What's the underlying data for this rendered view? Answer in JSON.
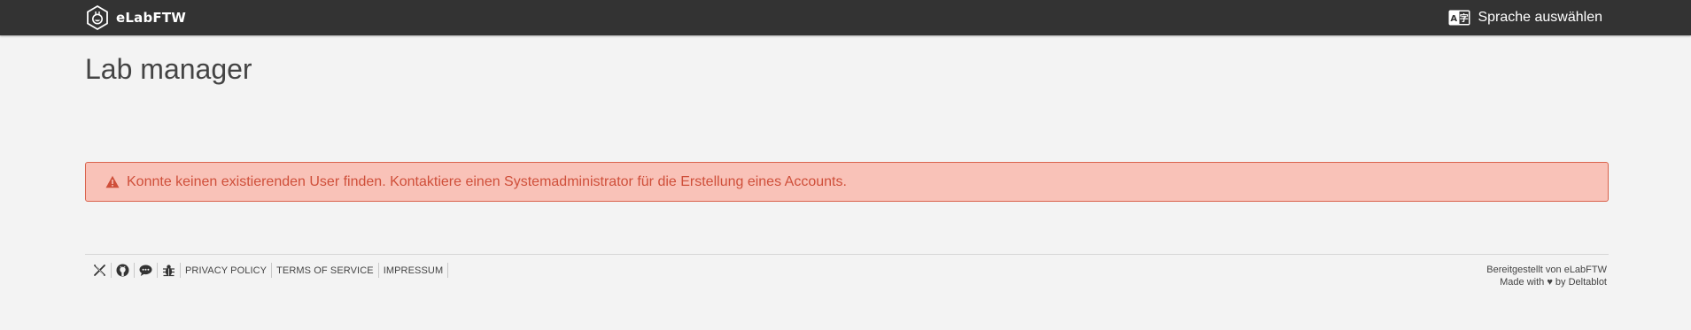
{
  "navbar": {
    "brand_label": "eLabFTW",
    "language_button_label": "Sprache auswählen",
    "language_icon": "language-icon"
  },
  "main": {
    "title": "Lab manager",
    "alert": {
      "icon": "warning-icon",
      "message": "Konnte keinen existierenden User finden. Kontaktiere einen Systemadministrator für die Erstellung eines Accounts.",
      "color": "#cf4f3a",
      "background": "#f9c2b8"
    }
  },
  "footer": {
    "icons": [
      "x-twitter-icon",
      "github-icon",
      "chat-icon",
      "bug-icon"
    ],
    "links": [
      "PRIVACY POLICY",
      "TERMS OF SERVICE",
      "IMPRESSUM"
    ],
    "provided_by": "Bereitgestellt von eLabFTW",
    "made_with": "Made with ♥ by Deltablot"
  },
  "colors": {
    "navbar_bg": "#333333",
    "page_bg": "#f3f3f3"
  }
}
